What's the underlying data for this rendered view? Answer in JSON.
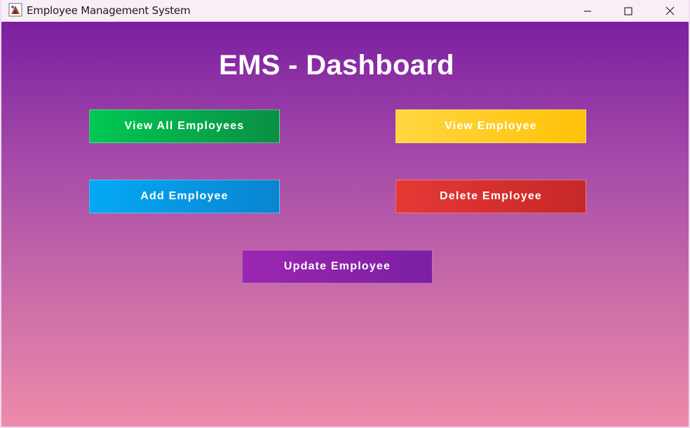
{
  "window": {
    "title": "Employee Management System",
    "controls": {
      "minimize": "minimize-icon",
      "maximize": "maximize-icon",
      "close": "close-icon"
    }
  },
  "dashboard": {
    "title": "EMS - Dashboard",
    "buttons": {
      "view_all": "View All Employees",
      "view": "View Employee",
      "add": "Add Employee",
      "delete": "Delete Employee",
      "update": "Update Employee"
    }
  },
  "colors": {
    "gradient_top": "#7b1fa2",
    "gradient_bottom": "#ee8bab",
    "view_all": "#00c853",
    "view": "#ffc107",
    "add": "#03a9f4",
    "delete": "#e53935",
    "update": "#9c27b0"
  }
}
